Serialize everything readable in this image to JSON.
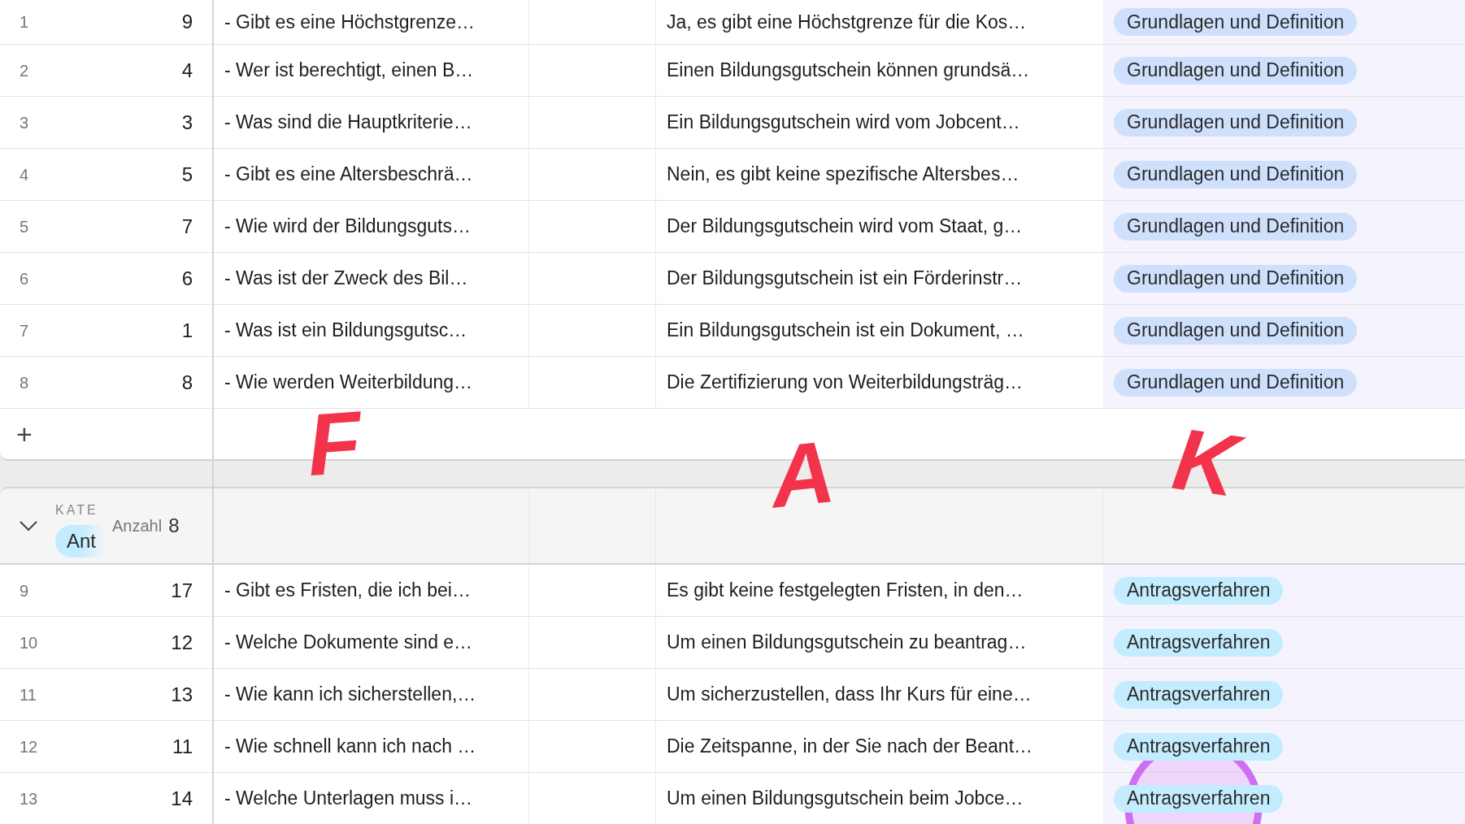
{
  "groups": [
    {
      "rows": [
        {
          "num": "1",
          "id": "9",
          "question": "- Gibt es eine Höchstgrenze…",
          "answer": "Ja, es gibt eine Höchstgrenze für die Kos…",
          "category": {
            "label": "Grundlagen und Definition",
            "color": "#cfe0fc"
          }
        },
        {
          "num": "2",
          "id": "4",
          "question": "- Wer ist berechtigt, einen B…",
          "answer": "Einen Bildungsgutschein können grundsä…",
          "category": {
            "label": "Grundlagen und Definition",
            "color": "#cfe0fc"
          }
        },
        {
          "num": "3",
          "id": "3",
          "question": "- Was sind die Hauptkriterie…",
          "answer": "Ein Bildungsgutschein wird vom Jobcent…",
          "category": {
            "label": "Grundlagen und Definition",
            "color": "#cfe0fc"
          }
        },
        {
          "num": "4",
          "id": "5",
          "question": "- Gibt es eine Altersbeschrä…",
          "answer": "Nein, es gibt keine spezifische Altersbes…",
          "category": {
            "label": "Grundlagen und Definition",
            "color": "#cfe0fc"
          }
        },
        {
          "num": "5",
          "id": "7",
          "question": "- Wie wird der Bildungsguts…",
          "answer": "Der Bildungsgutschein wird vom Staat, g…",
          "category": {
            "label": "Grundlagen und Definition",
            "color": "#cfe0fc"
          }
        },
        {
          "num": "6",
          "id": "6",
          "question": "- Was ist der Zweck des Bil…",
          "answer": "Der Bildungsgutschein ist ein Förderinstr…",
          "category": {
            "label": "Grundlagen und Definition",
            "color": "#cfe0fc"
          }
        },
        {
          "num": "7",
          "id": "1",
          "question": "- Was ist ein Bildungsgutsc…",
          "answer": "Ein Bildungsgutschein ist ein Dokument, …",
          "category": {
            "label": "Grundlagen und Definition",
            "color": "#cfe0fc"
          }
        },
        {
          "num": "8",
          "id": "8",
          "question": "- Wie werden Weiterbildung…",
          "answer": "Die Zertifizierung von Weiterbildungsträg…",
          "category": {
            "label": "Grundlagen und Definition",
            "color": "#cfe0fc"
          }
        }
      ],
      "add_row": "+"
    },
    {
      "header": {
        "expanded": true,
        "field_label": "KATE",
        "tag": {
          "label": "Ant",
          "color": "#c4ecff"
        },
        "count_label": "Anzahl",
        "count": "8"
      },
      "rows": [
        {
          "num": "9",
          "id": "17",
          "question": "- Gibt es Fristen, die ich bei…",
          "answer": "Es gibt keine festgelegten Fristen, in den…",
          "category": {
            "label": "Antragsverfahren",
            "color": "#c4ecff"
          }
        },
        {
          "num": "10",
          "id": "12",
          "question": "- Welche Dokumente sind e…",
          "answer": "Um einen Bildungsgutschein zu beantrag…",
          "category": {
            "label": "Antragsverfahren",
            "color": "#c4ecff"
          }
        },
        {
          "num": "11",
          "id": "13",
          "question": "- Wie kann ich sicherstellen,…",
          "answer": "Um sicherzustellen, dass Ihr Kurs für eine…",
          "category": {
            "label": "Antragsverfahren",
            "color": "#c4ecff"
          }
        },
        {
          "num": "12",
          "id": "11",
          "question": "- Wie schnell kann ich nach …",
          "answer": "Die Zeitspanne, in der Sie nach der Beant…",
          "category": {
            "label": "Antragsverfahren",
            "color": "#c4ecff"
          }
        },
        {
          "num": "13",
          "id": "14",
          "question": "- Welche Unterlagen muss i…",
          "answer": "Um einen Bildungsgutschein beim Jobce…",
          "category": {
            "label": "Antragsverfahren",
            "color": "#c4ecff"
          }
        }
      ]
    }
  ],
  "annotations": [
    {
      "kind": "letter",
      "text": "F"
    },
    {
      "kind": "letter",
      "text": "A"
    },
    {
      "kind": "letter",
      "text": "K"
    },
    {
      "kind": "circle"
    }
  ]
}
